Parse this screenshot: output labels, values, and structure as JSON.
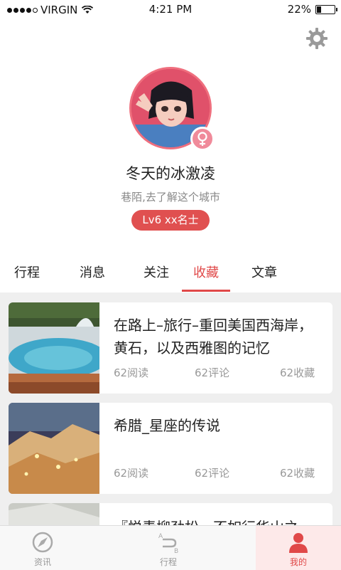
{
  "status_bar": {
    "carrier": "VIRGIN",
    "time": "4:21 PM",
    "battery": "22%",
    "battery_level": 0.22,
    "signal_bars": 4
  },
  "header": {
    "settings_icon": "gear-icon"
  },
  "profile": {
    "name": "冬天的冰激凌",
    "bio": "巷陌,去了解这个城市",
    "level_badge": "Lv6 xx名士",
    "gender_icon": "female-icon"
  },
  "tabs": [
    {
      "label": "行程"
    },
    {
      "label": "消息"
    },
    {
      "label": "关注"
    },
    {
      "label": "收藏",
      "active": true
    },
    {
      "label": "文章"
    }
  ],
  "articles": [
    {
      "title": "在路上–旅行–重回美国西海岸，黄石，以及西雅图的记忆",
      "reads": "62阅读",
      "comments": "62评论",
      "favorites": "62收藏"
    },
    {
      "title": "希腊_星座的传说",
      "reads": "62阅读",
      "comments": "62评论",
      "favorites": "62收藏"
    },
    {
      "title": "『悦青柳劲松，不如行华山之"
    }
  ],
  "bottom_nav": [
    {
      "label": "资讯",
      "icon": "compass-icon"
    },
    {
      "label": "行程",
      "icon": "route-icon"
    },
    {
      "label": "",
      "icon": ""
    },
    {
      "label": "我的",
      "icon": "user-icon",
      "active": true
    }
  ],
  "colors": {
    "accent": "#e04848",
    "badge": "#e05050",
    "background": "#efefef"
  }
}
